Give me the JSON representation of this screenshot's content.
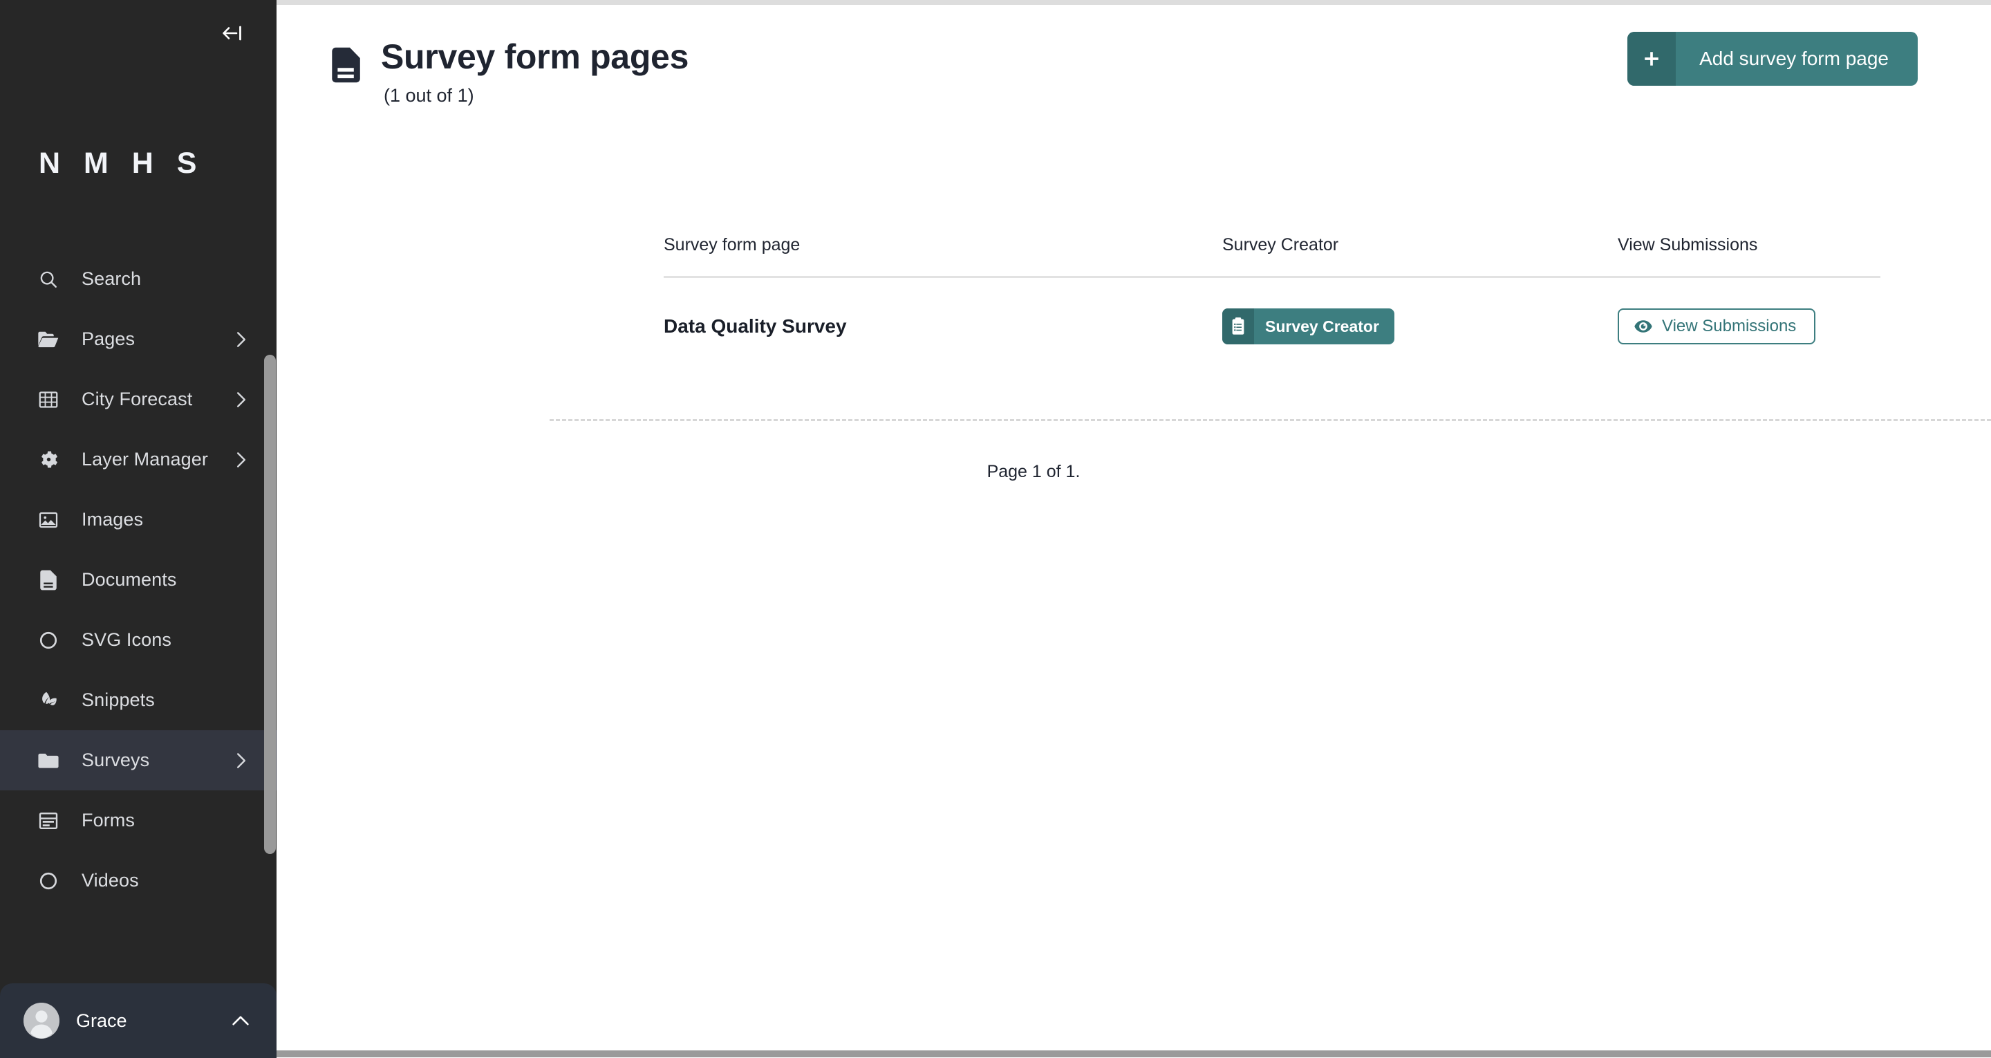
{
  "sidebar": {
    "collapse_icon": "collapse-left-icon",
    "brand": "N M H S",
    "items": [
      {
        "label": "Search",
        "icon": "search-icon",
        "has_chevron": false,
        "active": false
      },
      {
        "label": "Pages",
        "icon": "folder-open-icon",
        "has_chevron": true,
        "active": false
      },
      {
        "label": "City Forecast",
        "icon": "table-icon",
        "has_chevron": true,
        "active": false
      },
      {
        "label": "Layer Manager",
        "icon": "gear-icon",
        "has_chevron": true,
        "active": false
      },
      {
        "label": "Images",
        "icon": "image-icon",
        "has_chevron": false,
        "active": false
      },
      {
        "label": "Documents",
        "icon": "document-icon",
        "has_chevron": false,
        "active": false
      },
      {
        "label": "SVG Icons",
        "icon": "circle-icon",
        "has_chevron": false,
        "active": false
      },
      {
        "label": "Snippets",
        "icon": "leaf-icon",
        "has_chevron": false,
        "active": false
      },
      {
        "label": "Surveys",
        "icon": "folder-icon",
        "has_chevron": true,
        "active": true
      },
      {
        "label": "Forms",
        "icon": "form-icon",
        "has_chevron": false,
        "active": false
      },
      {
        "label": "Videos",
        "icon": "circle-icon",
        "has_chevron": false,
        "active": false
      }
    ],
    "user": {
      "name": "Grace",
      "avatar_icon": "avatar-icon",
      "chevron_icon": "chevron-up-icon"
    }
  },
  "header": {
    "icon": "document-icon",
    "title": "Survey form pages",
    "subtitle": "(1 out of 1)",
    "add_button": {
      "label": "Add survey form page",
      "icon": "plus-icon"
    }
  },
  "table": {
    "columns": [
      "Survey form page",
      "Survey Creator",
      "View Submissions"
    ],
    "rows": [
      {
        "name": "Data Quality Survey",
        "creator_button": {
          "label": "Survey Creator",
          "icon": "clipboard-list-icon"
        },
        "view_button": {
          "label": "View Submissions",
          "icon": "eye-icon"
        }
      }
    ]
  },
  "pagination": {
    "text": "Page 1 of 1."
  },
  "colors": {
    "sidebar_bg": "#272727",
    "sidebar_active": "#333640",
    "user_block_bg": "#2b313c",
    "teal": "#3d7e80",
    "teal_dark": "#31696b",
    "teal_text": "#337477",
    "heading": "#1f2430"
  }
}
